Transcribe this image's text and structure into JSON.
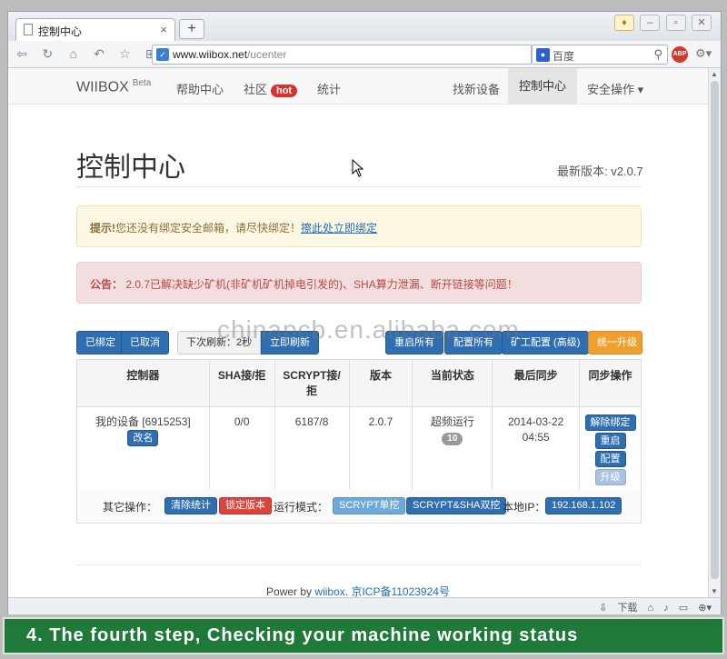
{
  "browser": {
    "tab_title": "控制中心",
    "tab_close": "×",
    "new_tab": "+",
    "url_host": "www.wiibox.net",
    "url_path": "/ucenter",
    "search_engine": "百度",
    "abp_label": "ABP"
  },
  "topnav": {
    "brand": "WIIBOX",
    "brand_sup": "Beta",
    "help": "帮助中心",
    "community": "社区",
    "hot": "hot",
    "stats": "统计",
    "find_device": "找新设备",
    "control_center": "控制中心",
    "security": "安全操作 ▾"
  },
  "header": {
    "title": "控制中心",
    "version_label": "最新版本:",
    "version": "v2.0.7"
  },
  "alerts": {
    "warn_prefix": "提示!",
    "warn_text": "您还没有绑定安全邮箱，请尽快绑定！",
    "warn_link": "擦此处立即绑定",
    "notice_prefix": "公告：",
    "notice_text": "2.0.7已解决缺少矿机(非矿机矿机掉电引发的)、SHA算力泄漏、断开链接等问题！"
  },
  "toolbar": {
    "bound": "已绑定",
    "cancelled": "已取消",
    "next_refresh": "下次刷新：2秒",
    "refresh_now": "立即刷新",
    "btn_a": "重启所有",
    "btn_b": "配置所有",
    "miner_config": "矿工配置 (高级)",
    "upgrade_all": "统一升级"
  },
  "table": {
    "headers": [
      "控制器",
      "SHA接/拒",
      "SCRYPT接/拒",
      "版本",
      "当前状态",
      "最后同步",
      "同步操作"
    ],
    "row": {
      "device": "我的设备 [6915253]",
      "rename": "改名",
      "sha": "0/0",
      "scrypt": "6187/8",
      "version": "2.0.7",
      "status": "超频运行",
      "status_badge": "10",
      "sync_date": "2014-03-22",
      "sync_time": "04:55",
      "unbind": "解除绑定",
      "restart": "重启",
      "config": "配置",
      "upgrade": "升级"
    }
  },
  "other": {
    "label": "其它操作：",
    "clear_stats": "清除统计",
    "lock_version": "锁定版本",
    "mode_label": "运行模式：",
    "scrypt_single": "SCRYPT单挖",
    "scrypt_sha_dual": "SCRYPT&SHA双挖",
    "ip_label": "本地IP：",
    "ip": "192.168.1.102"
  },
  "footer": {
    "power_by": "Power by",
    "wiibox": "wiibox.",
    "icp": "京ICP备11023924号"
  },
  "statusbar": {
    "download": "下载"
  },
  "watermark": "chinapcb.en.alibaba.com",
  "caption": "4. The fourth step, Checking your machine working status"
}
